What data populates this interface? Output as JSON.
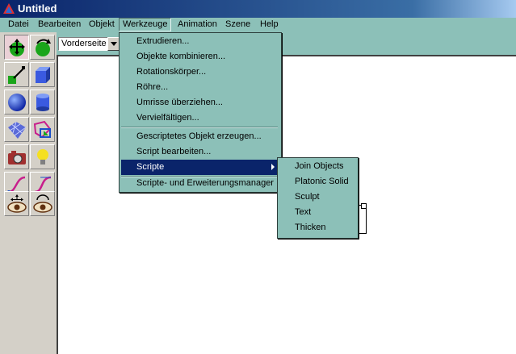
{
  "window": {
    "title": "Untitled"
  },
  "menubar": {
    "items": [
      "Datei",
      "Bearbeiten",
      "Objekt",
      "Werkzeuge",
      "Animation",
      "Szene",
      "Help"
    ],
    "active": "Werkzeuge"
  },
  "viewbar": {
    "view_value": "Vorderseite"
  },
  "tools_menu": {
    "group1": [
      "Extrudieren...",
      "Objekte kombinieren...",
      "Rotationskörper...",
      "Röhre...",
      "Umrisse überziehen...",
      "Vervielfältigen..."
    ],
    "group2": [
      "Gescriptetes Objekt erzeugen...",
      "Script bearbeiten..."
    ],
    "scripts_label": "Scripte",
    "manager_label": "Scripte- und Erweiterungsmanager"
  },
  "scripts_submenu": {
    "items": [
      "Join Objects",
      "Platonic Solid",
      "Sculpt",
      "Text",
      "Thicken"
    ]
  },
  "tool_palette": {
    "icons": [
      "move-tool-icon",
      "rotate-tool-icon",
      "light-wand-icon",
      "cube-icon",
      "sphere-icon",
      "cylinder-icon",
      "mesh-icon",
      "polygon-icon",
      "camera-icon",
      "light-bulb-icon",
      "curve-icon",
      "bezier-curve-icon",
      "move-view-icon",
      "rotate-view-icon"
    ]
  },
  "colors": {
    "menu_bg": "#8cc0b8",
    "title_bar": "#0a246a",
    "highlight": "#0a246a"
  }
}
